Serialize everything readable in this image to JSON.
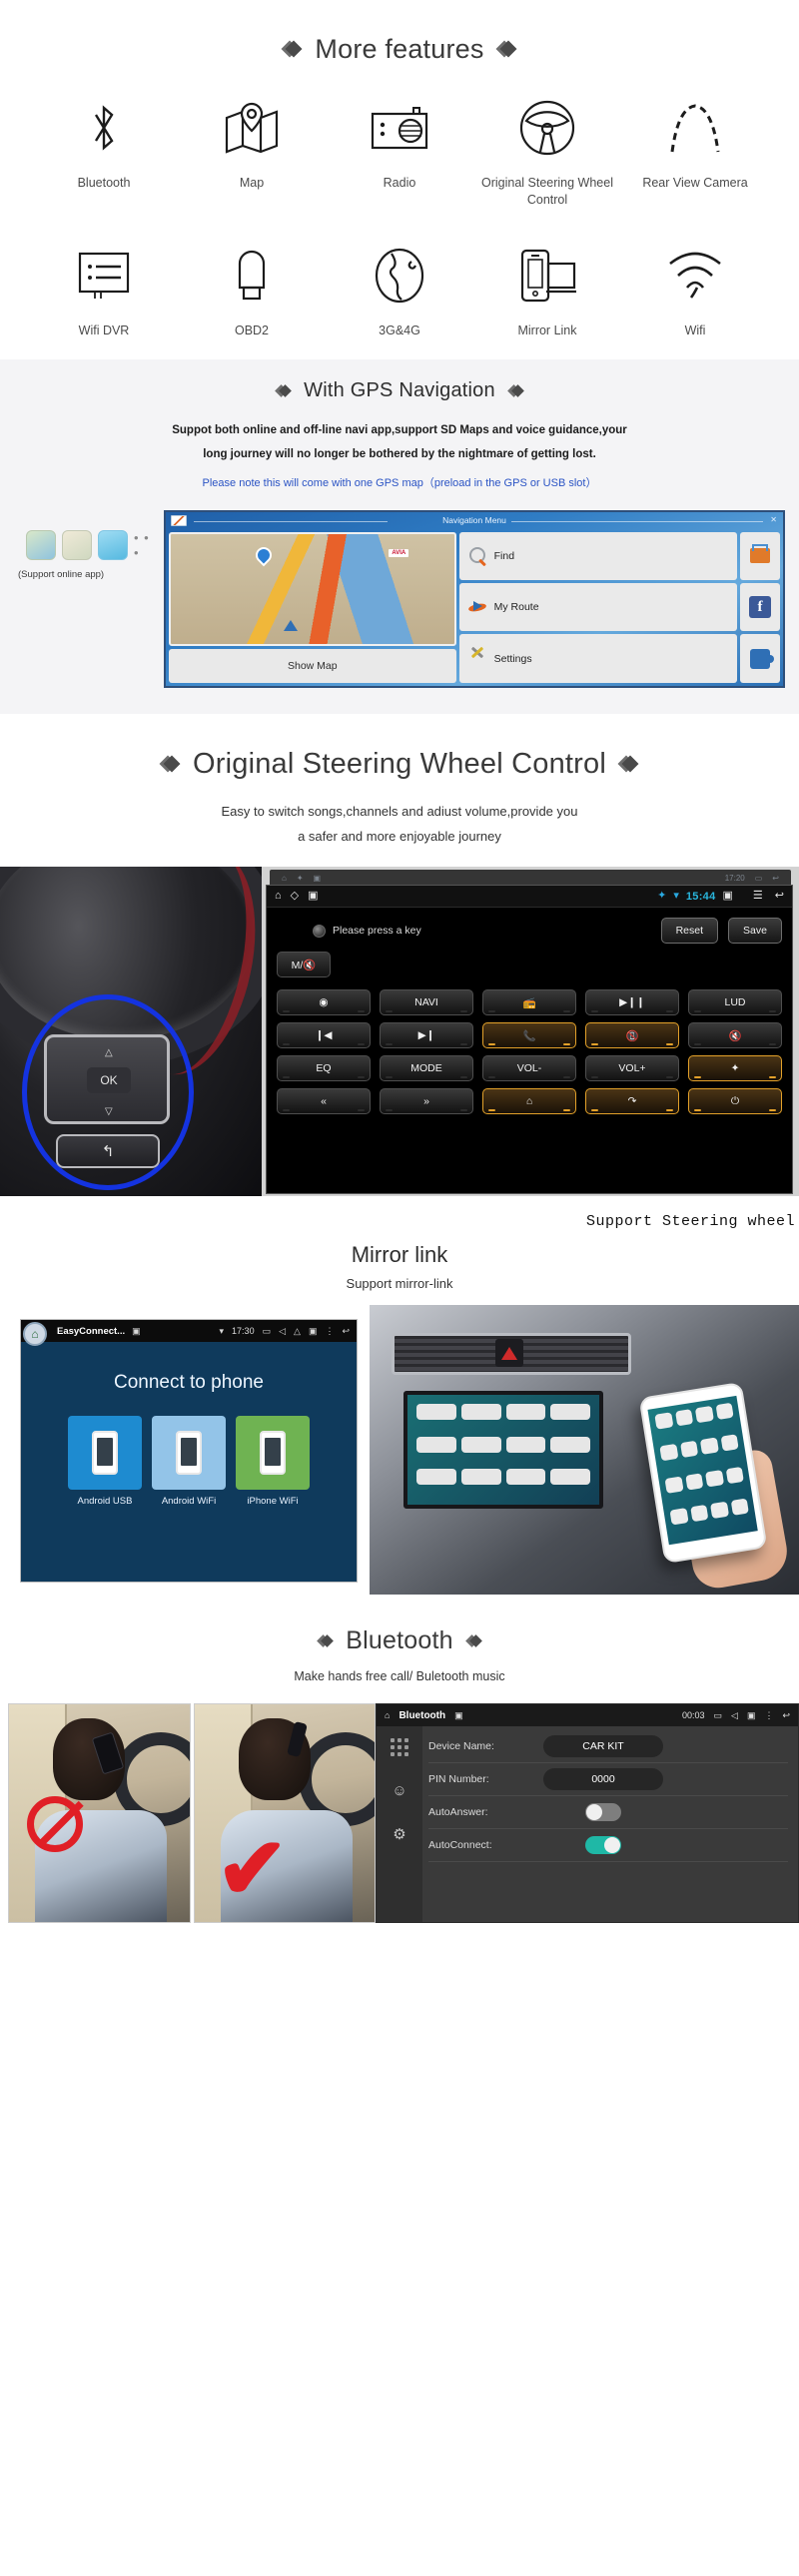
{
  "features": {
    "title": "More features",
    "row1": [
      {
        "icon": "bluetooth-icon",
        "label": "Bluetooth"
      },
      {
        "icon": "map-icon",
        "label": "Map"
      },
      {
        "icon": "radio-icon",
        "label": "Radio"
      },
      {
        "icon": "steering-wheel-icon",
        "label": "Original Steering Wheel Control"
      },
      {
        "icon": "rear-camera-icon",
        "label": "Rear View Camera"
      }
    ],
    "row2": [
      {
        "icon": "wifi-dvr-icon",
        "label": "Wifi DVR"
      },
      {
        "icon": "obd2-icon",
        "label": "OBD2"
      },
      {
        "icon": "globe-icon",
        "label": "3G&4G"
      },
      {
        "icon": "mirror-link-icon",
        "label": "Mirror Link"
      },
      {
        "icon": "wifi-icon",
        "label": "Wifi"
      }
    ]
  },
  "gps": {
    "title": "With GPS Navigation",
    "line1": "Suppot both online and off-line navi app,support SD Maps and voice guidance,your",
    "line2": "long journey will no longer be bothered by the nightmare of getting lost.",
    "note": "Please note this will come with one GPS map（preload in the GPS or USB slot）",
    "apps_caption": "(Support online app)",
    "apps_more": "• • •",
    "screen": {
      "menu_title": "Navigation Menu",
      "close": "✕",
      "show_map": "Show Map",
      "buttons": [
        "Find",
        "My Route",
        "Settings"
      ],
      "side_icons": [
        "cart-icon",
        "facebook-icon",
        "puzzle-icon"
      ]
    }
  },
  "swc": {
    "title": "Original Steering Wheel Control",
    "sub1": "Easy to switch songs,channels and adiust volume,provide you",
    "sub2": "a safer and more enjoyable journey",
    "caption": "Support Steering wheel",
    "wheel": {
      "ok": "OK",
      "up": "△",
      "down": "▽",
      "back": "↰"
    },
    "screen": {
      "status": {
        "clock": "15:44",
        "bt": "bluetooth-icon",
        "wifi": "wifi-icon",
        "home": "home-icon",
        "camera": "camera-icon",
        "menu": "menu-icon",
        "back": "back-icon"
      },
      "ghost_clock": "17:20",
      "prompt": "Please press a key",
      "reset": "Reset",
      "save": "Save",
      "mute_key": "M/🔇",
      "keys": [
        {
          "label": "◉",
          "hl": false
        },
        {
          "label": "NAVI",
          "hl": false
        },
        {
          "label": "📻",
          "hl": false
        },
        {
          "label": "▶❙❙",
          "hl": false
        },
        {
          "label": "LUD",
          "hl": false
        },
        {
          "label": "❙◀",
          "hl": false
        },
        {
          "label": "▶❙",
          "hl": false
        },
        {
          "label": "📞",
          "hl": true
        },
        {
          "label": "📵",
          "hl": true
        },
        {
          "label": "🔇",
          "hl": false
        },
        {
          "label": "EQ",
          "hl": false
        },
        {
          "label": "MODE",
          "hl": false
        },
        {
          "label": "VOL-",
          "hl": false
        },
        {
          "label": "VOL+",
          "hl": false
        },
        {
          "label": "✦",
          "hl": true
        },
        {
          "label": "«",
          "hl": false
        },
        {
          "label": "»",
          "hl": false
        },
        {
          "label": "⌂",
          "hl": true
        },
        {
          "label": "↷",
          "hl": true
        },
        {
          "label": "⏻",
          "hl": true
        }
      ]
    }
  },
  "mirror": {
    "title": "Mirror link",
    "sub": "Support mirror-link",
    "screen": {
      "app_title": "EasyConnect...",
      "time": "17:30",
      "heading": "Connect to phone",
      "tiles": [
        {
          "label": "Android USB",
          "color": "#1e8bd0"
        },
        {
          "label": "Android WiFi",
          "color": "#93c4e8"
        },
        {
          "label": "iPhone WiFi",
          "color": "#6fb352"
        }
      ]
    }
  },
  "bluetooth": {
    "title": "Bluetooth",
    "sub": "Make hands free call/ Buletooth music",
    "panel": {
      "title": "Bluetooth",
      "time": "00:03",
      "rows": [
        {
          "label": "Device Name:",
          "type": "value",
          "value": "CAR KIT"
        },
        {
          "label": "PIN Number:",
          "type": "value",
          "value": "0000"
        },
        {
          "label": "AutoAnswer:",
          "type": "toggle",
          "state": "off"
        },
        {
          "label": "AutoConnect:",
          "type": "toggle",
          "state": "on"
        }
      ]
    }
  },
  "colors": {
    "accent_orange": "#e3a12a",
    "accent_teal": "#1fb8a6",
    "accent_blue": "#2aa9e0",
    "link_blue": "#2a53c4",
    "red": "#e01f26"
  }
}
